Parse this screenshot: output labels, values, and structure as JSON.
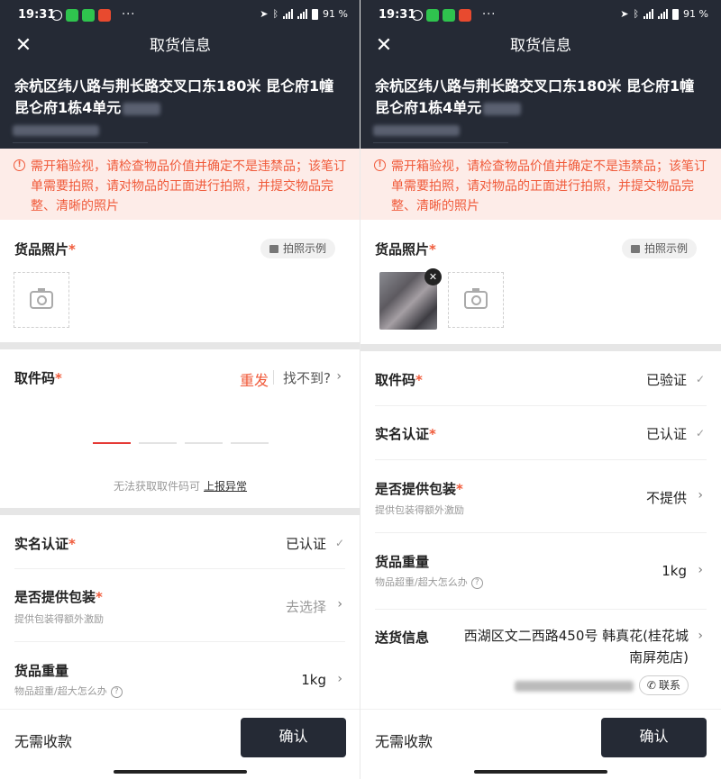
{
  "status": {
    "time": "19:31",
    "battery": "91 %",
    "more": "···"
  },
  "header": {
    "title": "取货信息",
    "address": "余杭区纬八路与荆长路交叉口东180米 昆仑府1幢 昆仑府1栋4单元"
  },
  "warning": "需开箱验视，请检查物品价值并确定不是违禁品；该笔订单需要拍照，请对物品的正面进行拍照，并提交物品完整、清晰的照片",
  "photo_section": {
    "label": "货品照片",
    "required": "*",
    "sample_button": "拍照示例"
  },
  "left": {
    "pickup_code": {
      "label": "取件码",
      "required": "*",
      "resend": "重发",
      "not_found": "找不到?",
      "code_digits": 4,
      "active_digit": 1
    },
    "report": {
      "text": "无法获取取件码可",
      "link": "上报异常"
    },
    "real_name": {
      "label": "实名认证",
      "required": "*",
      "value": "已认证"
    },
    "packaging": {
      "label": "是否提供包装",
      "required": "*",
      "sub": "提供包装得额外激励",
      "value": "去选择"
    },
    "weight": {
      "label": "货品重量",
      "sub": "物品超重/超大怎么办",
      "value": "1kg"
    }
  },
  "right": {
    "pickup_code": {
      "label": "取件码",
      "required": "*",
      "value": "已验证"
    },
    "real_name": {
      "label": "实名认证",
      "required": "*",
      "value": "已认证"
    },
    "packaging": {
      "label": "是否提供包装",
      "required": "*",
      "sub": "提供包装得额外激励",
      "value": "不提供"
    },
    "weight": {
      "label": "货品重量",
      "sub": "物品超重/超大怎么办",
      "value": "1kg"
    },
    "delivery": {
      "label": "送货信息",
      "address": "西湖区文二西路450号 韩真花(桂花城南屏苑店)",
      "contact_button": "联系"
    }
  },
  "footer": {
    "no_payment": "无需收款",
    "confirm": "确认"
  },
  "colors": {
    "header_bg": "#252a35",
    "accent": "#f05a3a",
    "warning_bg": "#fdece8"
  }
}
